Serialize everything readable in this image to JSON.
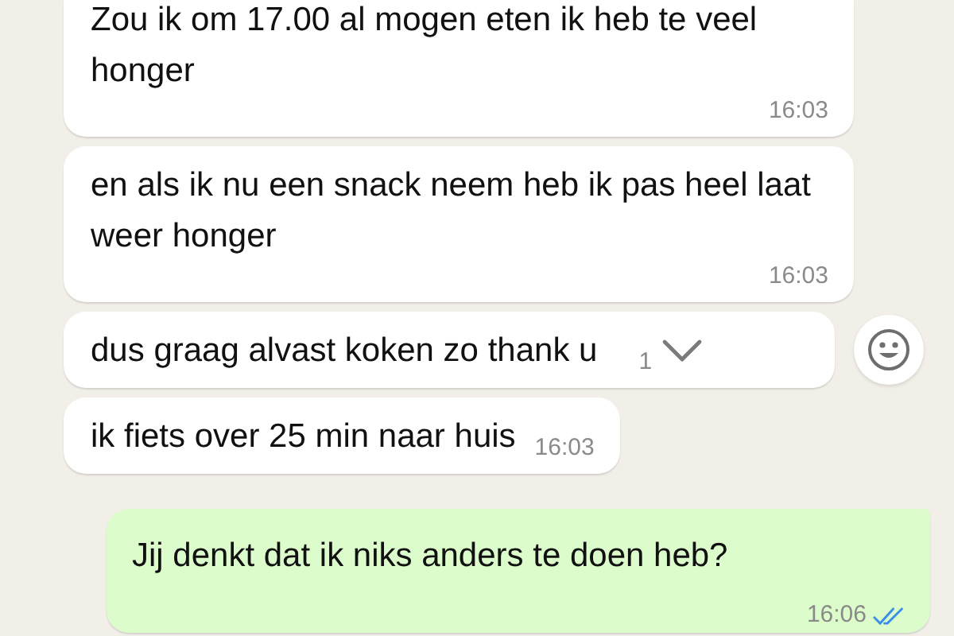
{
  "messages": [
    {
      "kind": "incoming",
      "text": "Zou ik om 17.00 al mogen eten ik heb te veel honger",
      "time": "16:03",
      "show_actions": false
    },
    {
      "kind": "incoming",
      "text": "en als ik nu een snack neem heb ik pas heel laat weer honger",
      "time": "16:03",
      "show_actions": false
    },
    {
      "kind": "incoming",
      "text": "dus graag alvast koken zo thank u",
      "time": "1",
      "show_actions": true
    },
    {
      "kind": "incoming",
      "text": "ik fiets over 25 min naar huis",
      "time": "16:03",
      "show_actions": false
    },
    {
      "kind": "outgoing",
      "text": "Jij denkt dat ik niks anders te doen heb?",
      "time": "16:06",
      "read": true
    }
  ]
}
